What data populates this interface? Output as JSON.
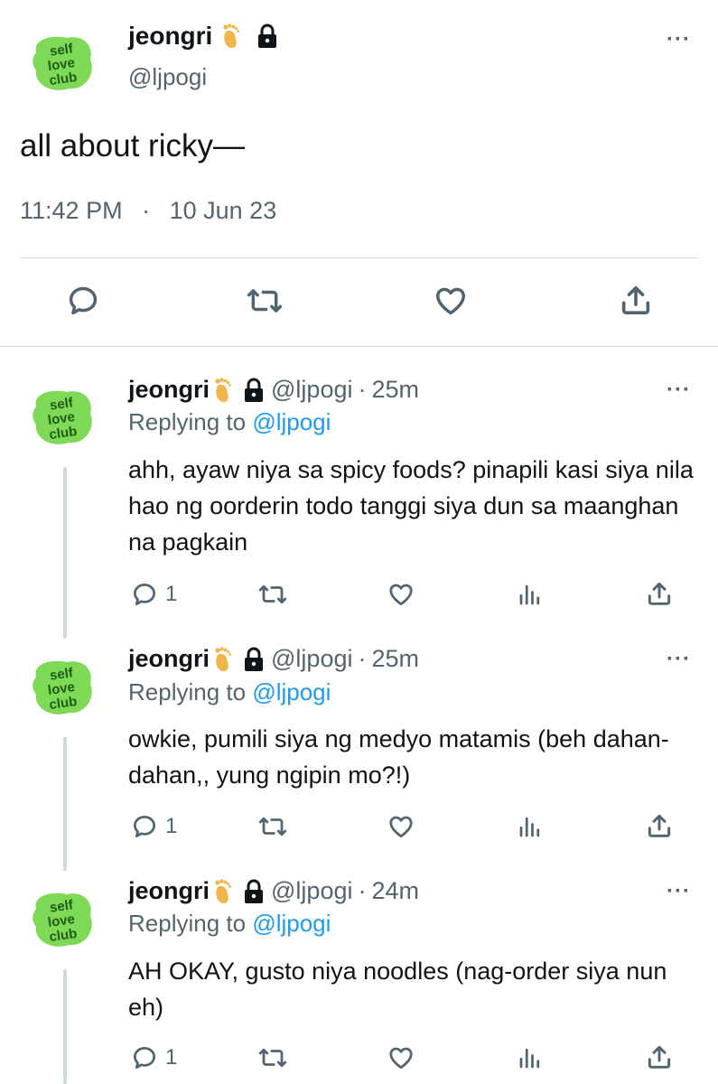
{
  "main_tweet": {
    "display_name": "jeongri",
    "name_emoji": "foot-emoji",
    "handle": "@ljpogi",
    "text": "all about ricky—",
    "time": "11:42 PM",
    "date": "10 Jun 23",
    "separator": "·",
    "more": "···"
  },
  "avatar": {
    "line1": "self",
    "line2": "love",
    "line3": "club",
    "bg": "#7ed957"
  },
  "replies": [
    {
      "display_name": "jeongri",
      "handle": "@ljpogi",
      "sep": "·",
      "age": "25m",
      "replying_prefix": "Replying to",
      "mention": "@ljpogi",
      "text": "ahh, ayaw niya sa spicy foods? pinapili kasi siya nila hao ng oorderin todo tanggi siya dun sa maanghan na pagkain",
      "reply_count": "1",
      "more": "···"
    },
    {
      "display_name": "jeongri",
      "handle": "@ljpogi",
      "sep": "·",
      "age": "25m",
      "replying_prefix": "Replying to",
      "mention": "@ljpogi",
      "text": "owkie, pumili siya ng medyo matamis (beh dahan-dahan,, yung ngipin mo?!)",
      "reply_count": "1",
      "more": "···"
    },
    {
      "display_name": "jeongri",
      "handle": "@ljpogi",
      "sep": "·",
      "age": "24m",
      "replying_prefix": "Replying to",
      "mention": "@ljpogi",
      "text": "AH OKAY, gusto niya noodles (nag-order siya nun eh)",
      "reply_count": "1",
      "more": "···"
    }
  ],
  "colors": {
    "link": "#1d9bf0",
    "muted": "#536471",
    "text": "#0f1419",
    "divider": "#d7dbdf"
  },
  "icons": [
    "reply-icon",
    "retweet-icon",
    "like-icon",
    "share-icon",
    "views-icon",
    "lock-icon",
    "more-icon"
  ]
}
